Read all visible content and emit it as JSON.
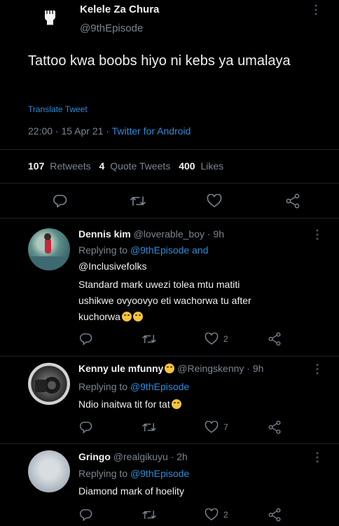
{
  "tweet": {
    "author_name": "Kelele Za Chura",
    "author_handle": "@9thEpisode",
    "text": "Tattoo kwa boobs hiyo ni kebs ya umalaya",
    "translate_label": "Translate Tweet",
    "time": "22:00 · 15 Apr 21 ·",
    "source": "Twitter for Android",
    "stats": {
      "retweets_count": "107",
      "retweets_label": "Retweets",
      "quotes_count": "4",
      "quotes_label": "Quote Tweets",
      "likes_count": "400",
      "likes_label": "Likes"
    }
  },
  "replies": [
    {
      "name": "Dennis kim",
      "handle_time": "@loverable_boy · 9h",
      "replying_prefix": "Replying to",
      "replying_to": "@9thEpisode and",
      "replying_to_2": "@Inclusivefolks",
      "text_lines": [
        "Standard mark uwezi tolea mtu matiti",
        "ushikwe ovyoovyo eti wachorwa tu after",
        "kuchorwa"
      ],
      "like_count": "2"
    },
    {
      "name": "Kenny ule mfunny",
      "handle_time": "@Reingskenny · 9h",
      "replying_prefix": "Replying to",
      "replying_to": "@9thEpisode",
      "text_lines": [
        "Ndio inaitwa tit for tat"
      ],
      "like_count": "7"
    },
    {
      "name": "Gringo",
      "handle_time": "@realgikuyu · 2h",
      "replying_prefix": "Replying to",
      "replying_to": "@9thEpisode",
      "text_lines": [
        "Diamond mark of hoelity"
      ],
      "like_count": "2"
    }
  ],
  "colors": {
    "background": "#000000",
    "accent": "#2a8ddd",
    "muted": "#7a8591",
    "text": "#e7e9ea"
  },
  "icons": [
    "fist-logo-icon",
    "more-icon",
    "reply-icon",
    "retweet-icon",
    "like-icon",
    "share-icon"
  ]
}
